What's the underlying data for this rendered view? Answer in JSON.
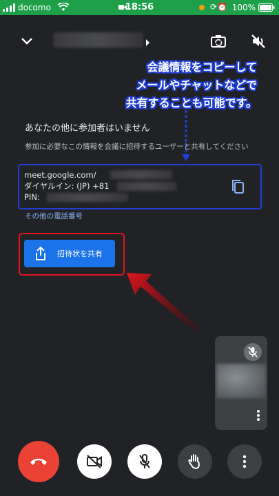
{
  "status_bar": {
    "carrier": "docomo",
    "time": "18:56",
    "battery": "100%"
  },
  "icons": {
    "collapse": "chevron-down-icon",
    "switch_camera": "switch-camera-icon",
    "speaker_off": "speaker-off-icon",
    "copy": "copy-icon",
    "share": "share-icon",
    "mic_off": "mic-off-icon",
    "more": "more-vertical-icon",
    "end_call": "end-call-icon",
    "camera_off": "camera-off-icon",
    "raise_hand": "raise-hand-icon"
  },
  "annotation": {
    "line1": "会議情報をコピーして",
    "line2": "メールやチャットなどで",
    "line3": "共有することも可能です。"
  },
  "main": {
    "no_participants": "あなたの他に参加者はいません",
    "instruction": "参加に必要なこの情報を会議に招待するユーザーと共有してください",
    "meeting_info": {
      "link": "meet.google.com/",
      "dial_in": "ダイヤルイン: (JP) +81",
      "pin": "PIN:"
    },
    "other_numbers": "その他の電話番号",
    "share_button": "招待状を共有"
  },
  "colors": {
    "accent": "#1a73e8",
    "highlight_blue": "#1f3fd6",
    "highlight_red": "#e1141e",
    "end_call": "#ea4335",
    "status_bar": "#1ea04b"
  }
}
